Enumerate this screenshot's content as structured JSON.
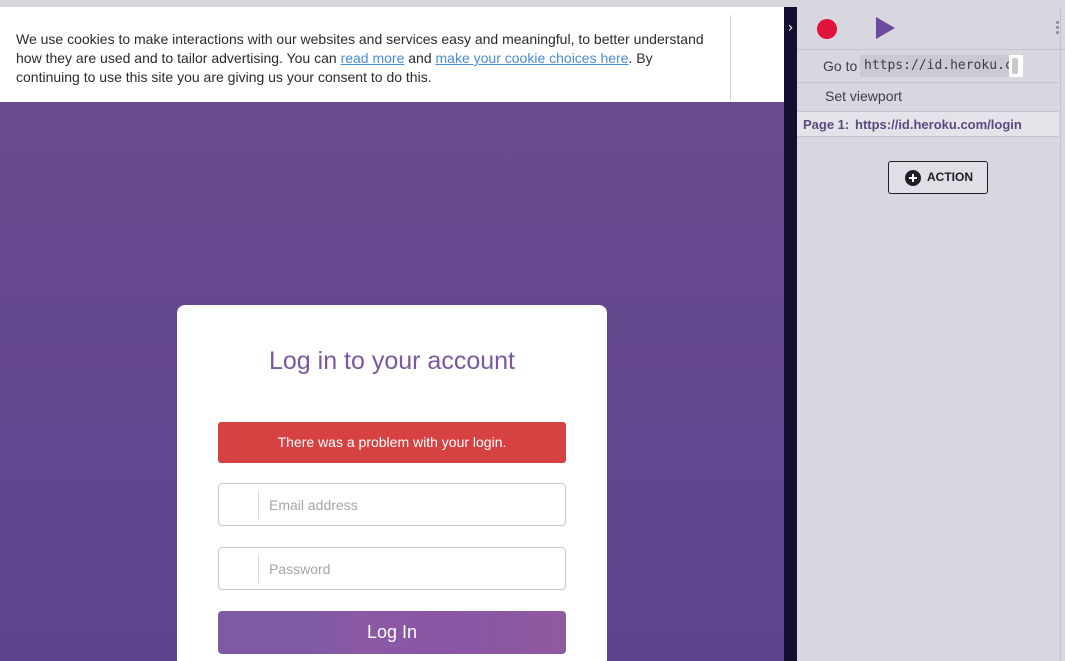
{
  "cookie_banner": {
    "text_before": "We use cookies to make interactions with our websites and services easy and meaningful, to better understand how they are used and to tailor advertising. You can ",
    "link_read_more": "read more",
    "text_and": " and ",
    "link_choices": "make your cookie choices here",
    "text_after": ". By continuing to use this site you are giving us your consent to do this."
  },
  "login": {
    "title": "Log in to your account",
    "error": "There was a problem with your login.",
    "email_placeholder": "Email address",
    "password_placeholder": "Password",
    "submit_label": "Log In"
  },
  "panel": {
    "toggle_glyph": "›",
    "goto_label": "Go to",
    "goto_url": "https://id.heroku.com",
    "set_viewport_label": "Set viewport",
    "page_label": "Page 1:",
    "page_url": "https://id.heroku.com/login",
    "action_label": "ACTION"
  },
  "colors": {
    "page_background": "#6a4b8c",
    "error": "#d64242",
    "record": "#e0143c",
    "play": "#6b4a9f",
    "title": "#79589f"
  }
}
